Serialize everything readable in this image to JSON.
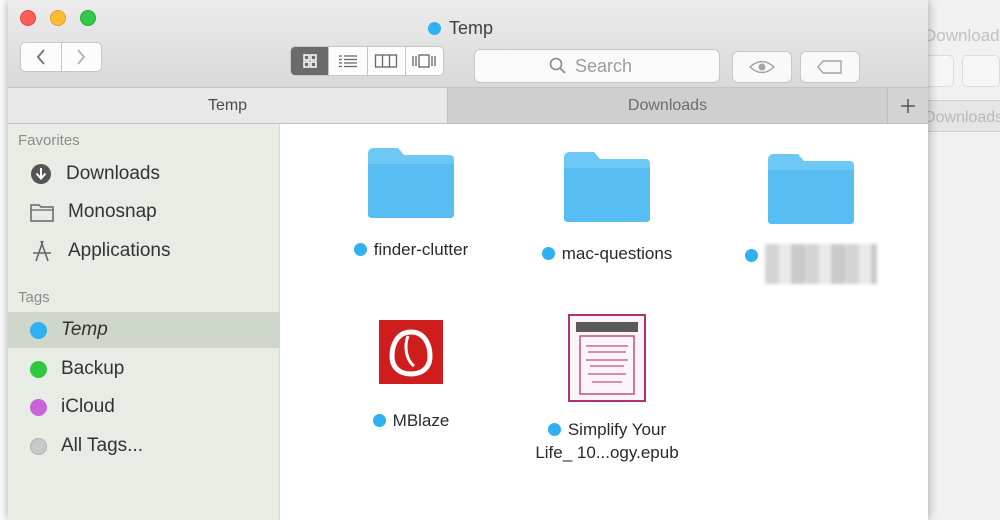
{
  "window": {
    "title": "Temp",
    "title_tag_color": "#2fb0f0"
  },
  "background_window": {
    "title": "Downloads",
    "tab_label": "Downloads"
  },
  "toolbar": {
    "search_placeholder": "Search",
    "nav_icons": [
      "back-icon",
      "forward-icon"
    ],
    "view_modes": [
      "icon-view-icon",
      "list-view-icon",
      "column-view-icon",
      "cover-flow-icon"
    ],
    "active_view": "icon-view-icon"
  },
  "tabs": [
    {
      "label": "Temp",
      "active": true
    },
    {
      "label": "Downloads",
      "active": false
    }
  ],
  "sidebar": {
    "favorites_title": "Favorites",
    "favorites": [
      {
        "label": "Downloads",
        "icon": "download-icon"
      },
      {
        "label": "Monosnap",
        "icon": "folder-icon"
      },
      {
        "label": "Applications",
        "icon": "applications-icon"
      }
    ],
    "tags_title": "Tags",
    "tags": [
      {
        "label": "Temp",
        "color": "#2fb0f0",
        "selected": true
      },
      {
        "label": "Backup",
        "color": "#31c73f",
        "selected": false
      },
      {
        "label": "iCloud",
        "color": "#c864d7",
        "selected": false
      },
      {
        "label": "All Tags...",
        "color": "#c8c8c8",
        "selected": false
      }
    ]
  },
  "files": [
    {
      "name": "finder-clutter",
      "type": "folder",
      "tag_color": "#2fb0f0"
    },
    {
      "name": "mac-questions",
      "type": "folder",
      "tag_color": "#2fb0f0"
    },
    {
      "name": "",
      "type": "folder",
      "tag_color": "#2fb0f0",
      "redacted": true
    },
    {
      "name": "MBlaze",
      "type": "app",
      "tag_color": "#2fb0f0"
    },
    {
      "name_line1": "Simplify Your",
      "name_line2": "Life_ 10...ogy.epub",
      "type": "epub",
      "tag_color": "#2fb0f0"
    }
  ]
}
